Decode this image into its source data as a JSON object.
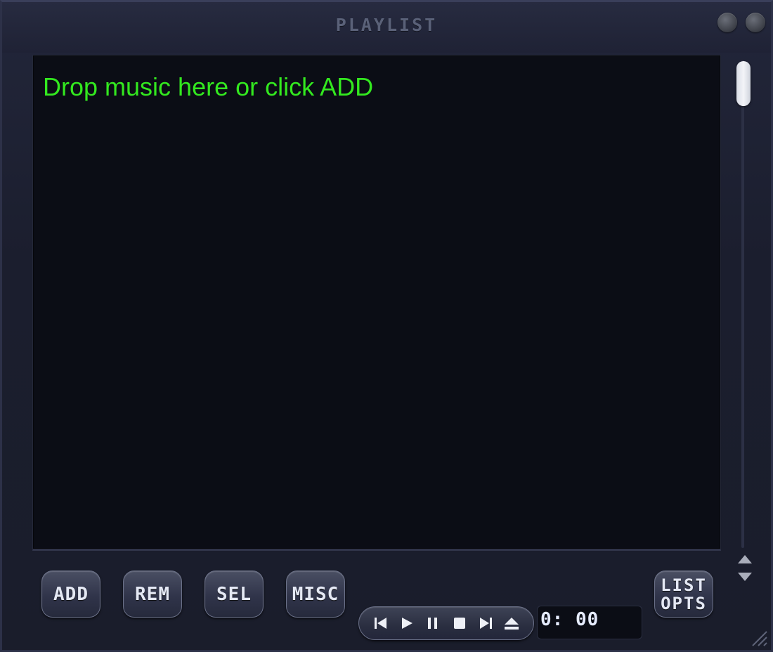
{
  "window": {
    "title": "PLAYLIST"
  },
  "playlist": {
    "empty_message": "Drop music here or click ADD"
  },
  "buttons": {
    "add": "ADD",
    "rem": "REM",
    "sel": "SEL",
    "misc": "MISC",
    "list_opts_line1": "LIST",
    "list_opts_line2": "OPTS"
  },
  "transport": {
    "controls": [
      "previous-icon",
      "play-icon",
      "pause-icon",
      "stop-icon",
      "next-icon",
      "eject-icon"
    ],
    "time": "0: 00"
  },
  "colors": {
    "message_green": "#33e81f",
    "background": "#1a1d2b",
    "list_background": "#0b0d15"
  }
}
